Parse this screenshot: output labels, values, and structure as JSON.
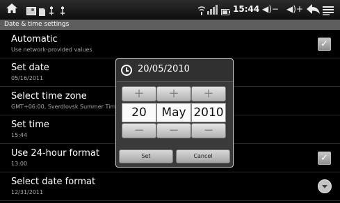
{
  "statusbar": {
    "time": "15:44",
    "icons": [
      "home-icon",
      "photo-icon",
      "sd-card-icon",
      "usb-icon",
      "usb-icon",
      "wifi-icon",
      "signal-icon",
      "battery-icon",
      "volume-down-icon",
      "volume-up-icon",
      "back-icon",
      "menu-icon"
    ],
    "volume_down_glyph": "◀)−",
    "volume_up_glyph": "◀)+"
  },
  "header": {
    "title": "Date & time settings"
  },
  "settings": [
    {
      "title": "Automatic",
      "subtitle": "Use network-provided values",
      "control": "checkbox",
      "checked": false
    },
    {
      "title": "Set date",
      "subtitle": "05/16/2011"
    },
    {
      "title": "Select time zone",
      "subtitle": "GMT+06:00, Sverdlovsk Summer Time"
    },
    {
      "title": "Set time",
      "subtitle": "15:44"
    },
    {
      "title": "Use 24-hour format",
      "subtitle": "13:00",
      "control": "checkbox",
      "checked": true
    },
    {
      "title": "Select date format",
      "subtitle": "12/31/2011",
      "control": "dropdown"
    }
  ],
  "dialog": {
    "title": "20/05/2010",
    "day": "20",
    "month": "May",
    "year": "2010",
    "plus": "+",
    "minus": "−",
    "set_label": "Set",
    "cancel_label": "Cancel"
  },
  "colors": {
    "background": "#000000",
    "header": "#5e5e5e",
    "dialog": "#3a3a3a"
  }
}
